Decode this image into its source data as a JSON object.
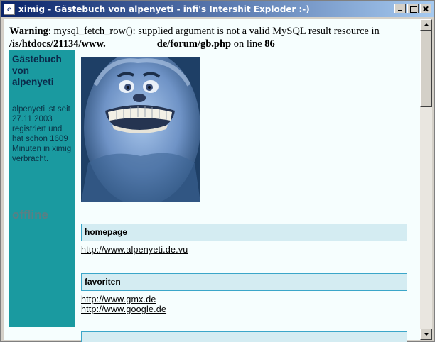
{
  "window": {
    "title": "ximig - Gästebuch von alpenyeti - infi's Intershit Exploder :-)",
    "icon": "e-icon"
  },
  "warning": {
    "label": "Warning",
    "message": ": mysql_fetch_row(): supplied argument is not a valid MySQL result resource in",
    "path_part1": "/is/htdocs/21134/www.",
    "path_part2": "de/forum/gb.php",
    "on_line": "on line",
    "line_number": "86"
  },
  "sidebar": {
    "title": "Gästebuch von alpenyeti",
    "info": "alpenyeti ist seit 27.11.2003 registriert und hat schon 1609 Minuten in ximig verbracht.",
    "status": "offline"
  },
  "sections": [
    {
      "heading": "homepage",
      "links": [
        "http://www.alpenyeti.de.vu"
      ]
    },
    {
      "heading": "favoriten",
      "links": [
        "http://www.gmx.de",
        "http://www.google.de"
      ]
    }
  ],
  "colors": {
    "sidebar_bg": "#1a9aa0",
    "section_bg": "#d4ecf2",
    "section_border": "#3ba6c9",
    "page_bg": "#f6fefe"
  }
}
